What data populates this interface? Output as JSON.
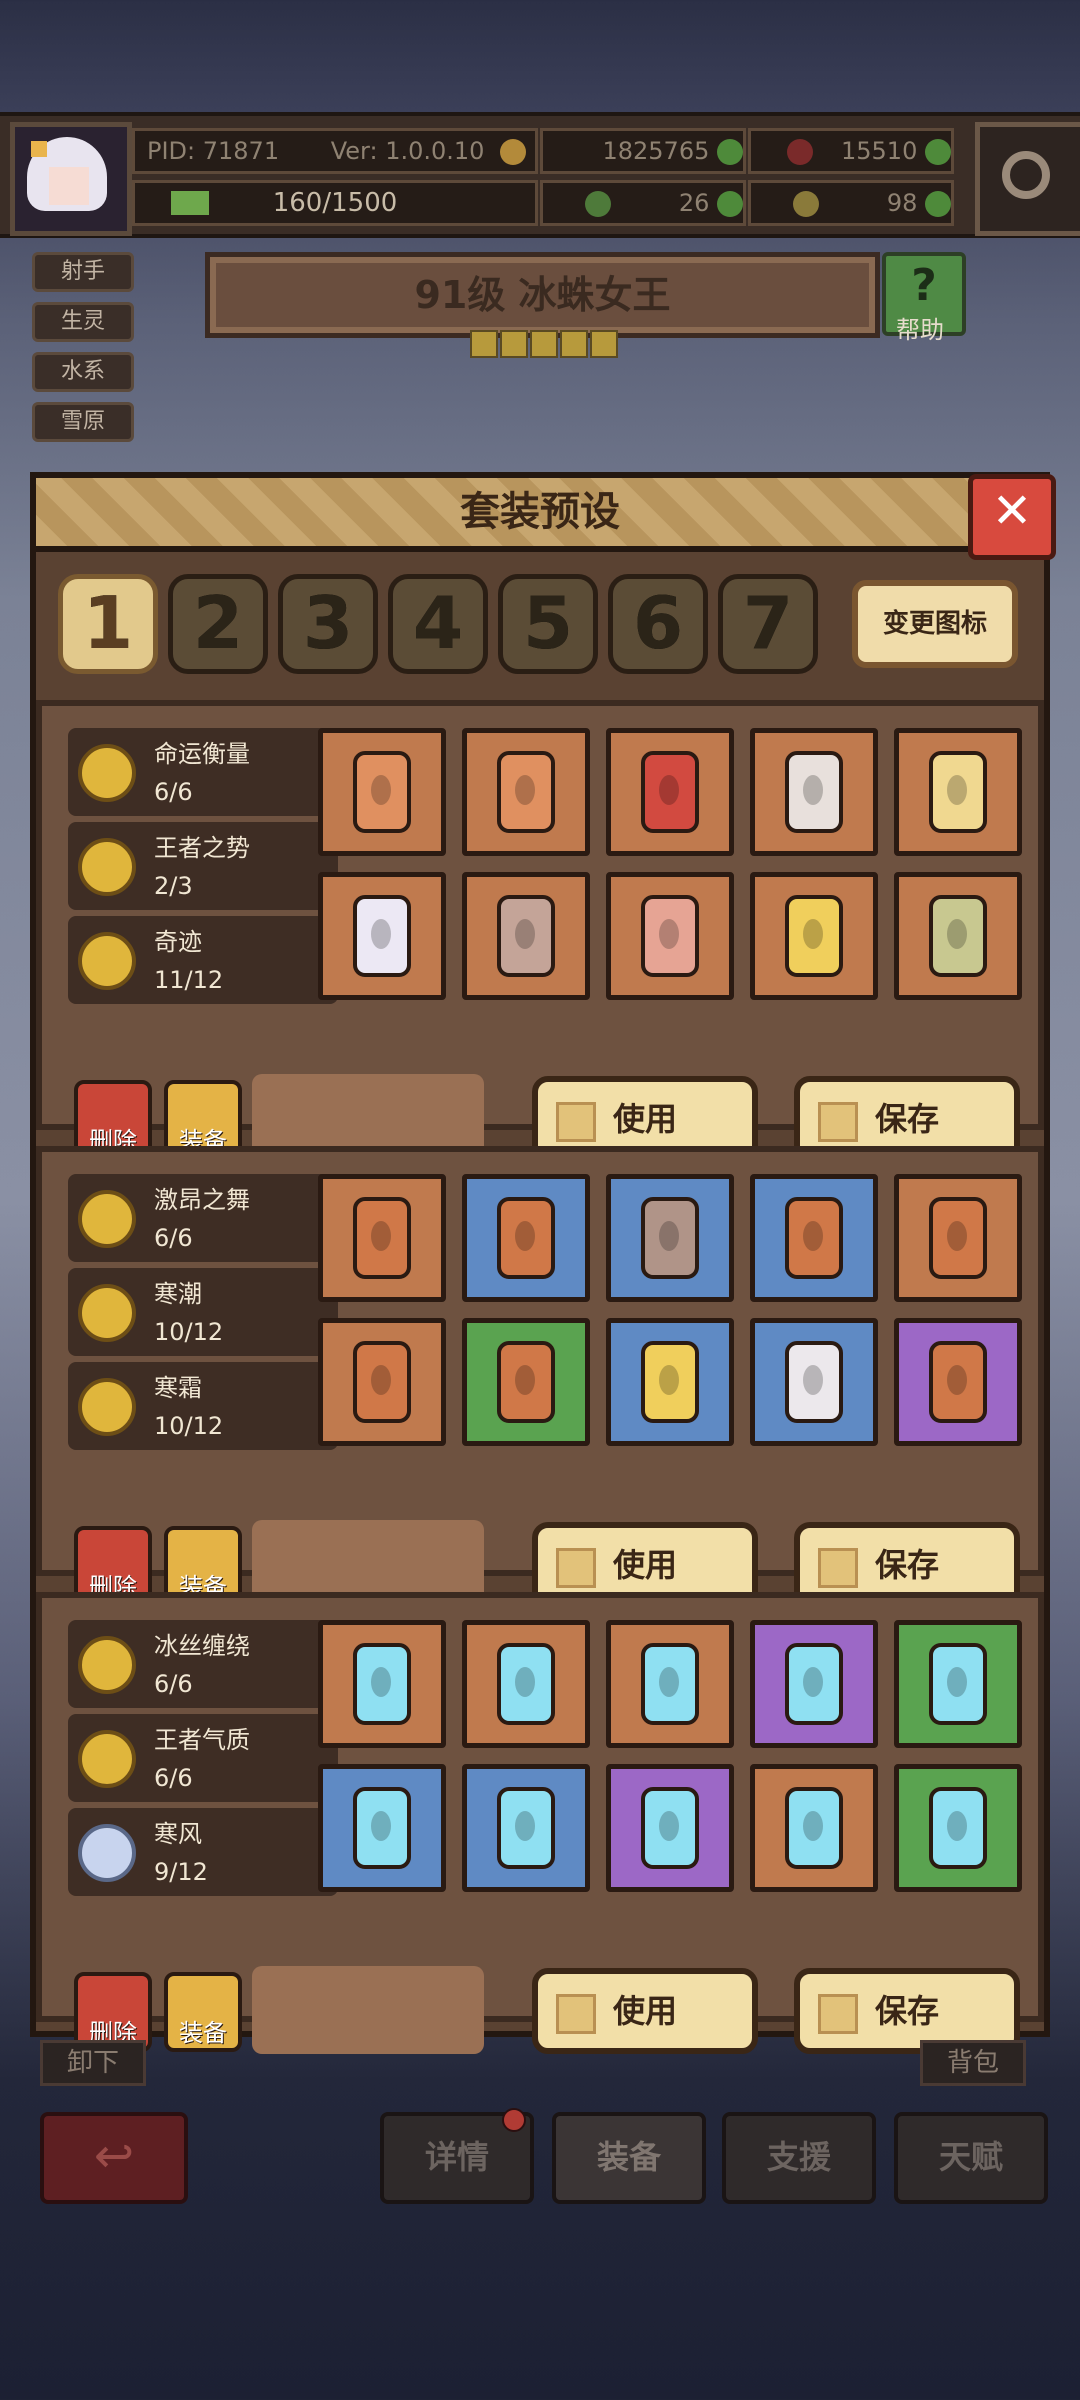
{
  "header": {
    "pid": "PID: 71871",
    "version": "Ver: 1.0.0.10",
    "gold": "1825765",
    "gems": "15510",
    "energy": "160/1500",
    "clover": "26",
    "item": "98"
  },
  "tags": [
    "射手",
    "生灵",
    "水系",
    "雪原"
  ],
  "title": "91级  冰蛛女王",
  "help_label": "帮助",
  "dialog": {
    "title": "套装预设",
    "close": "✕",
    "tabs": [
      "1",
      "2",
      "3",
      "4",
      "5",
      "6",
      "7"
    ],
    "change_icon": "变更图标",
    "presets": [
      {
        "sets": [
          {
            "name": "命运衡量",
            "count": "6/6"
          },
          {
            "name": "王者之势",
            "count": "2/3"
          },
          {
            "name": "奇迹",
            "count": "11/12"
          }
        ],
        "use": "使用",
        "save": "保存",
        "delete": "删除",
        "equip": "装备"
      },
      {
        "sets": [
          {
            "name": "激昂之舞",
            "count": "6/6"
          },
          {
            "name": "寒潮",
            "count": "10/12"
          },
          {
            "name": "寒霜",
            "count": "10/12"
          }
        ],
        "use": "使用",
        "save": "保存",
        "delete": "删除",
        "equip": "装备"
      },
      {
        "sets": [
          {
            "name": "冰丝缠绕",
            "count": "6/6"
          },
          {
            "name": "王者气质",
            "count": "6/6"
          },
          {
            "name": "寒风",
            "count": "9/12"
          }
        ],
        "use": "使用",
        "save": "保存",
        "delete": "删除",
        "equip": "装备"
      }
    ]
  },
  "bottom": {
    "unload": "卸下",
    "bag": "背包",
    "nav": [
      "详情",
      "装备",
      "支援",
      "天赋"
    ],
    "back": "↩"
  },
  "colors": {
    "card_orange": "#c07a4e",
    "card_blue": "#5f8ac4",
    "card_green": "#5aa350",
    "card_purple": "#9c68c6"
  }
}
